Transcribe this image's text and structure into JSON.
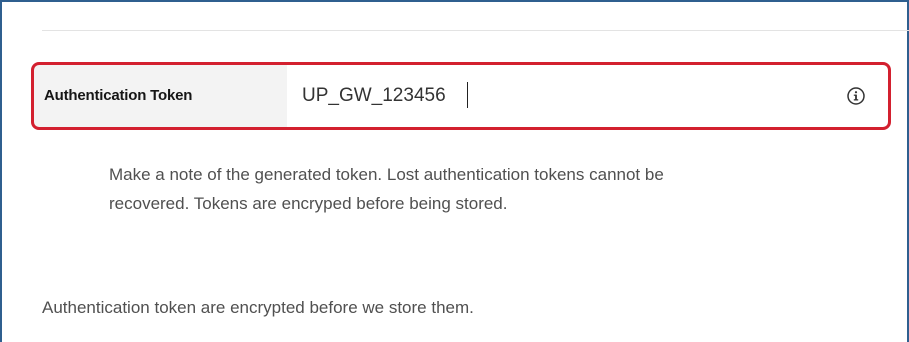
{
  "auth_token": {
    "label": "Authentication Token",
    "value": "UP_GW_123456",
    "info_icon": "info-circle-icon",
    "help_text": "Make a note of the generated token. Lost authentication tokens cannot be recovered. Tokens are encryped before being stored."
  },
  "footer_note": "Authentication token are encrypted before we store them.",
  "colors": {
    "highlight_border": "#d3202f",
    "frame_border": "#2f5f8f"
  }
}
